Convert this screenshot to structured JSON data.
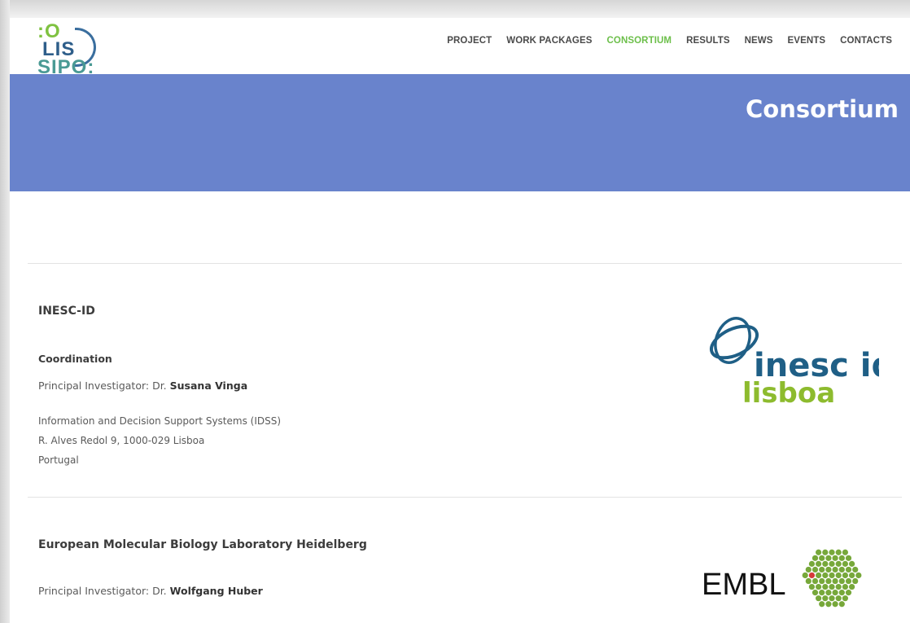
{
  "site": {
    "logo": {
      "line1": ":O",
      "line2": "LIS",
      "line3": "SIPO:"
    }
  },
  "nav": {
    "items": [
      {
        "label": "PROJECT",
        "active": false
      },
      {
        "label": "WORK PACKAGES",
        "active": false
      },
      {
        "label": "CONSORTIUM",
        "active": true
      },
      {
        "label": "RESULTS",
        "active": false
      },
      {
        "label": "NEWS",
        "active": false
      },
      {
        "label": "EVENTS",
        "active": false
      },
      {
        "label": "CONTACTS",
        "active": false
      }
    ]
  },
  "hero": {
    "title": "Consortium"
  },
  "partners": [
    {
      "name": "INESC-ID",
      "role": "Coordination",
      "pi_prefix": "Principal Investigator: Dr. ",
      "pi_name": "Susana Vinga",
      "address": [
        "Information and Decision Support Systems (IDSS)",
        "R. Alves Redol 9, 1000-029 Lisboa",
        "Portugal"
      ],
      "logo": {
        "word1": "inesc id",
        "word2": "lisboa"
      }
    },
    {
      "name": "European Molecular Biology Laboratory Heidelberg",
      "pi_prefix": "Principal Investigator: Dr. ",
      "pi_name": "Wolfgang Huber",
      "logo": {
        "word1": "EMBL"
      }
    }
  ],
  "colors": {
    "hero_bg": "#6983cc",
    "nav_active": "#6cbf4a",
    "inesc_blue": "#1f5f86",
    "inesc_green": "#8dbb2e",
    "embl_green": "#77a83a",
    "embl_red": "#d63a3a"
  }
}
